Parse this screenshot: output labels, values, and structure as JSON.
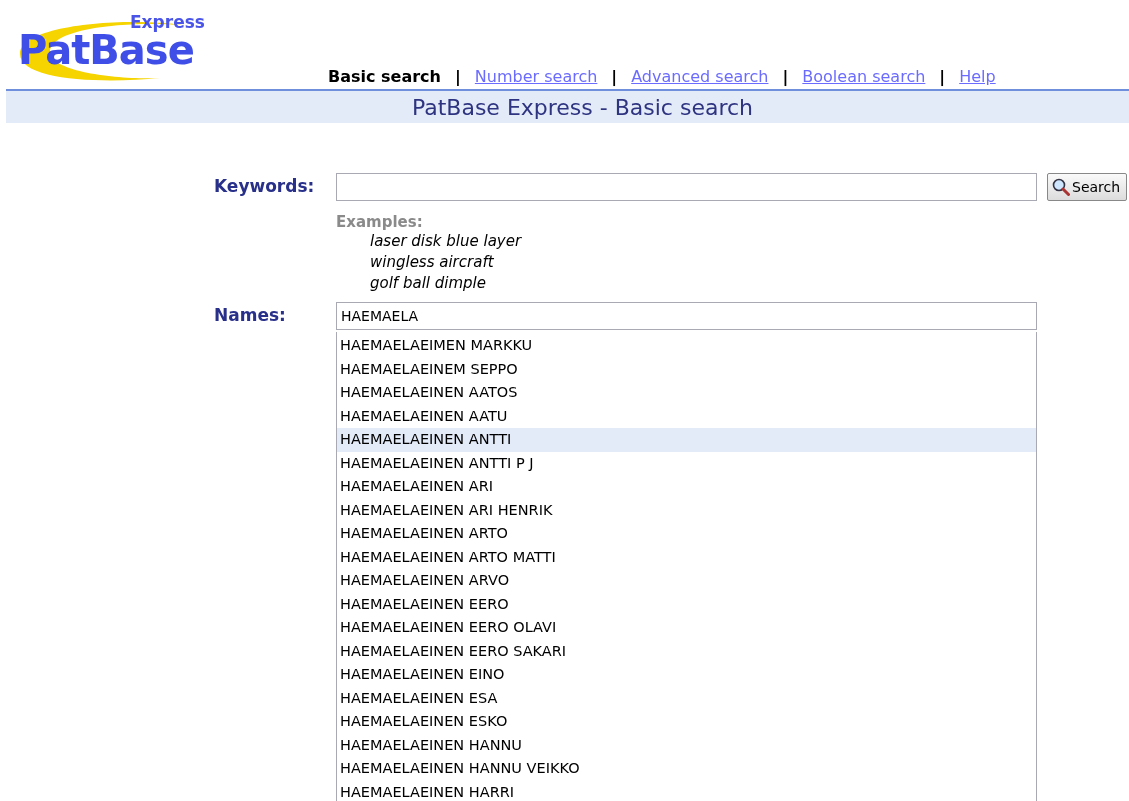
{
  "logo": {
    "name": "PatBase",
    "edition": "Express"
  },
  "nav_separator": "|",
  "nav": [
    {
      "label": "Basic search",
      "selected": true
    },
    {
      "label": "Number search",
      "selected": false
    },
    {
      "label": "Advanced search",
      "selected": false
    },
    {
      "label": "Boolean search",
      "selected": false
    },
    {
      "label": "Help",
      "selected": false
    }
  ],
  "page_title": "PatBase Express - Basic search",
  "keywords": {
    "label": "Keywords:",
    "button": "Search"
  },
  "examples": {
    "heading": "Examples:",
    "items": [
      "laser disk blue layer",
      "wingless aircraft",
      "golf ball dimple"
    ]
  },
  "names": {
    "label": "Names:",
    "value": "HAEMAELA"
  },
  "suggestions": [
    {
      "text": "HAEMAELAEIMEN MARKKU",
      "selected": false
    },
    {
      "text": "HAEMAELAEINEM SEPPO",
      "selected": false
    },
    {
      "text": "HAEMAELAEINEN AATOS",
      "selected": false
    },
    {
      "text": "HAEMAELAEINEN AATU",
      "selected": false
    },
    {
      "text": "HAEMAELAEINEN ANTTI",
      "selected": true
    },
    {
      "text": "HAEMAELAEINEN ANTTI P J",
      "selected": false
    },
    {
      "text": "HAEMAELAEINEN ARI",
      "selected": false
    },
    {
      "text": "HAEMAELAEINEN ARI HENRIK",
      "selected": false
    },
    {
      "text": "HAEMAELAEINEN ARTO",
      "selected": false
    },
    {
      "text": "HAEMAELAEINEN ARTO MATTI",
      "selected": false
    },
    {
      "text": "HAEMAELAEINEN ARVO",
      "selected": false
    },
    {
      "text": "HAEMAELAEINEN EERO",
      "selected": false
    },
    {
      "text": "HAEMAELAEINEN EERO OLAVI",
      "selected": false
    },
    {
      "text": "HAEMAELAEINEN EERO SAKARI",
      "selected": false
    },
    {
      "text": "HAEMAELAEINEN EINO",
      "selected": false
    },
    {
      "text": "HAEMAELAEINEN ESA",
      "selected": false
    },
    {
      "text": "HAEMAELAEINEN ESKO",
      "selected": false
    },
    {
      "text": "HAEMAELAEINEN HANNU",
      "selected": false
    },
    {
      "text": "HAEMAELAEINEN HANNU VEIKKO",
      "selected": false
    },
    {
      "text": "HAEMAELAEINEN HARRI",
      "selected": false
    }
  ]
}
